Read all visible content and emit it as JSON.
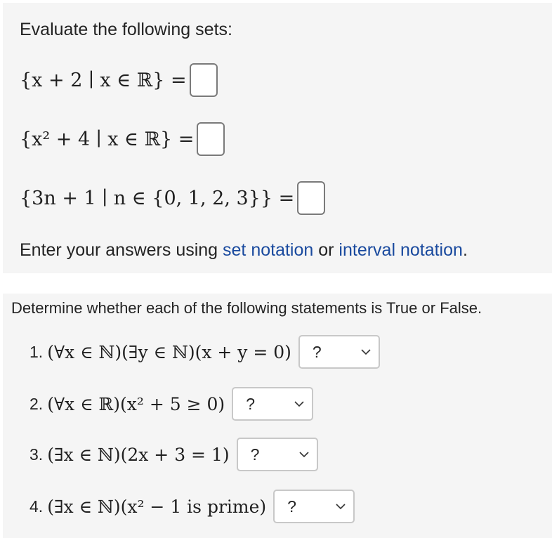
{
  "section1": {
    "prompt": "Evaluate the following sets:",
    "sets": [
      "{x + 2 ∣ x ∈ ℝ} =",
      "{x² + 4 ∣ x ∈ ℝ} =",
      "{3n + 1 ∣ n ∈ {0, 1, 2, 3}} ="
    ],
    "answers": [
      "",
      "",
      ""
    ],
    "note_prefix": "Enter your answers using ",
    "link_set": "set notation",
    "note_or": " or ",
    "link_interval": "interval notation",
    "note_suffix": "."
  },
  "section2": {
    "prompt": "Determine whether each of the following statements is True or False.",
    "statements": [
      {
        "number": "1.",
        "expr": "(∀x ∈ ℕ)(∃y ∈ ℕ)(x + y = 0)",
        "selected": "?"
      },
      {
        "number": "2.",
        "expr": "(∀x ∈ ℝ)(x² + 5 ≥ 0)",
        "selected": "?"
      },
      {
        "number": "3.",
        "expr": "(∃x ∈ ℕ)(2x + 3 = 1)",
        "selected": "?"
      },
      {
        "number": "4.",
        "expr": "(∃x ∈ ℕ)(x² − 1 is prime)",
        "selected": "?"
      }
    ]
  },
  "icons": {
    "dropdown": "chevron-down-icon"
  },
  "colors": {
    "link": "#1a4a9e",
    "panel": "#f5f5f5"
  }
}
